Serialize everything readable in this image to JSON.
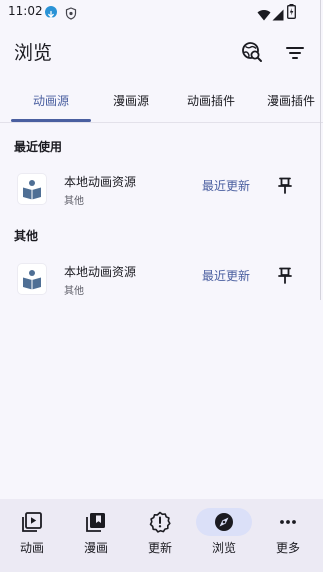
{
  "status_bar": {
    "time": "11:02"
  },
  "header": {
    "title": "浏览"
  },
  "tabs": [
    {
      "label": "动画源",
      "active": true
    },
    {
      "label": "漫画源",
      "active": false
    },
    {
      "label": "动画插件",
      "active": false
    },
    {
      "label": "漫画插件",
      "active": false
    }
  ],
  "sections": [
    {
      "title": "最近使用",
      "items": [
        {
          "name": "本地动画资源",
          "category": "其他",
          "action_label": "最近更新"
        }
      ]
    },
    {
      "title": "其他",
      "items": [
        {
          "name": "本地动画资源",
          "category": "其他",
          "action_label": "最近更新"
        }
      ]
    }
  ],
  "bottom_nav": [
    {
      "label": "动画",
      "icon": "play-square-icon",
      "active": false
    },
    {
      "label": "漫画",
      "icon": "library-icon",
      "active": false
    },
    {
      "label": "更新",
      "icon": "alert-badge-icon",
      "active": false
    },
    {
      "label": "浏览",
      "icon": "compass-icon",
      "active": true
    },
    {
      "label": "更多",
      "icon": "more-horizontal-icon",
      "active": false
    }
  ],
  "colors": {
    "accent": "#4a5fa0",
    "background": "#f7f6fc",
    "nav_background": "#eceaf4",
    "nav_active_pill": "#dbe0f8"
  }
}
